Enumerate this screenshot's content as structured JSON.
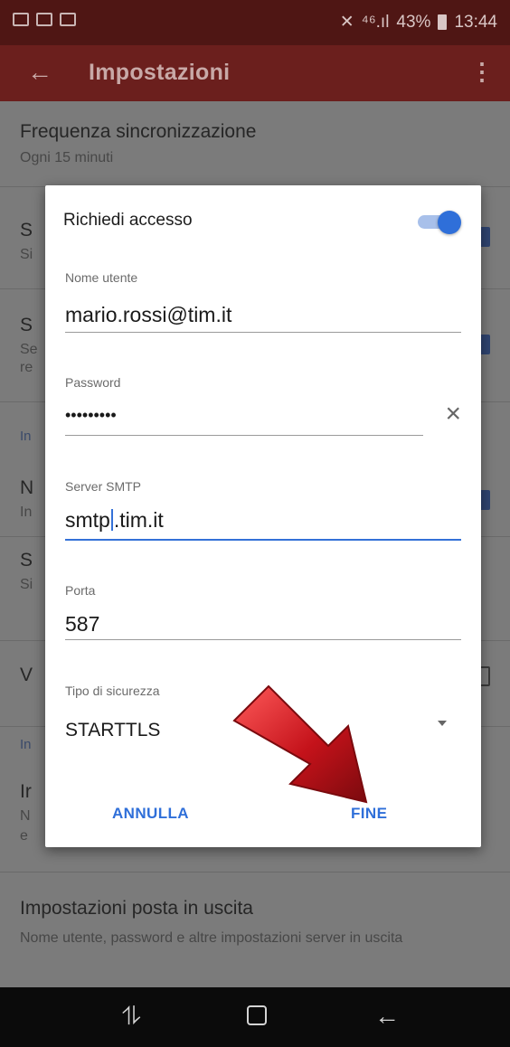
{
  "status_bar": {
    "battery": "43%",
    "time": "13:44",
    "signal_text": "⁴⁶.ıl"
  },
  "app_bar": {
    "title": "Impostazioni"
  },
  "settings": {
    "sync_title": "Frequenza sincronizzazione",
    "sync_sub": "Ogni 15 minuti",
    "row2_title": "S",
    "row2_sub": "Si",
    "row3_title": "S",
    "row3_sub_1": "Se",
    "row3_sub_2": "re",
    "section1": "In",
    "row4_title": "N",
    "row4_sub": "In",
    "row5_title": "S",
    "row5_sub": "Si",
    "row6_title": "V",
    "section2": "In",
    "row7_title": "Ir",
    "row7_sub_1": "N",
    "row7_sub_2": "e",
    "outgoing_title": "Impostazioni posta in uscita",
    "outgoing_sub": "Nome utente, password e altre impostazioni server in uscita"
  },
  "dialog": {
    "require_access_label": "Richiedi accesso",
    "username_label": "Nome utente",
    "username_value": "mario.rossi@tim.it",
    "password_label": "Password",
    "password_value": "•••••••••",
    "smtp_label": "Server SMTP",
    "smtp_value_before": "smtp",
    "smtp_value_after": ".tim.it",
    "port_label": "Porta",
    "port_value": "587",
    "security_label": "Tipo di sicurezza",
    "security_value": "STARTTLS",
    "cancel_label": "ANNULLA",
    "done_label": "FINE",
    "toggle_on": true
  },
  "colors": {
    "status_bar": "#4f1614",
    "app_bar": "#6b1f1d",
    "accent": "#2f6fd9",
    "arrow": "#c4121a"
  }
}
